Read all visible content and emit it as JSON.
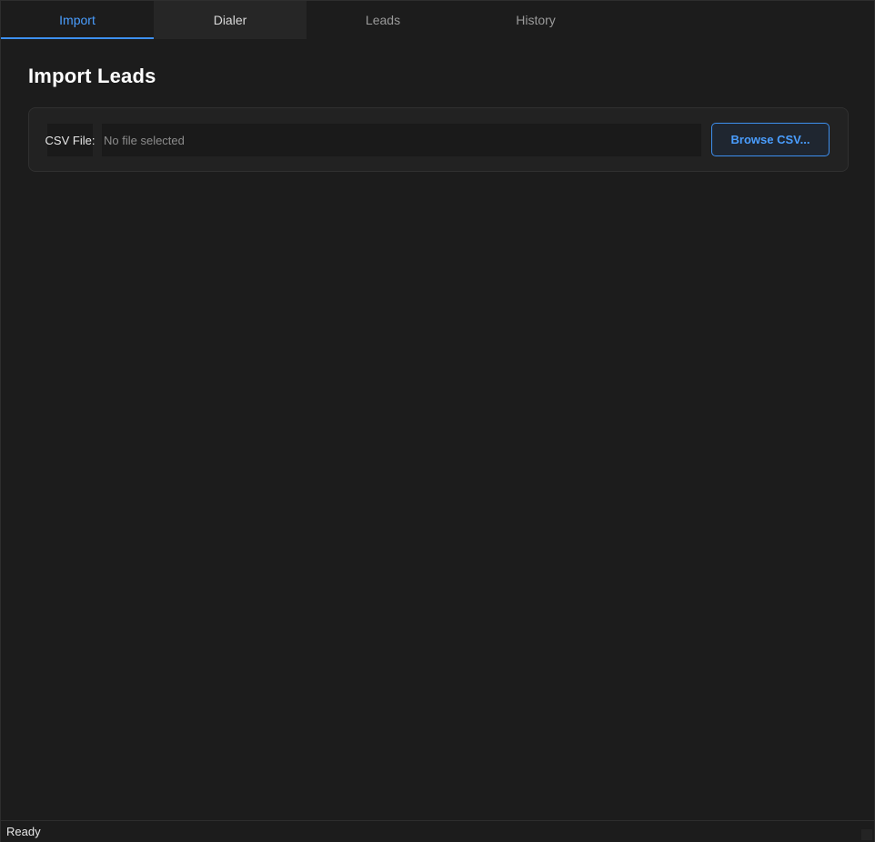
{
  "tabs": [
    {
      "label": "Import",
      "state": "active"
    },
    {
      "label": "Dialer",
      "state": "hover"
    },
    {
      "label": "Leads",
      "state": "normal"
    },
    {
      "label": "History",
      "state": "normal"
    }
  ],
  "import": {
    "title": "Import Leads",
    "csv_label": "CSV File:",
    "file_placeholder": "No file selected",
    "file_value": "",
    "browse_label": "Browse CSV..."
  },
  "status": {
    "text": "Ready"
  },
  "colors": {
    "accent": "#4a9eff",
    "background": "#1c1c1c",
    "card": "#222222"
  }
}
